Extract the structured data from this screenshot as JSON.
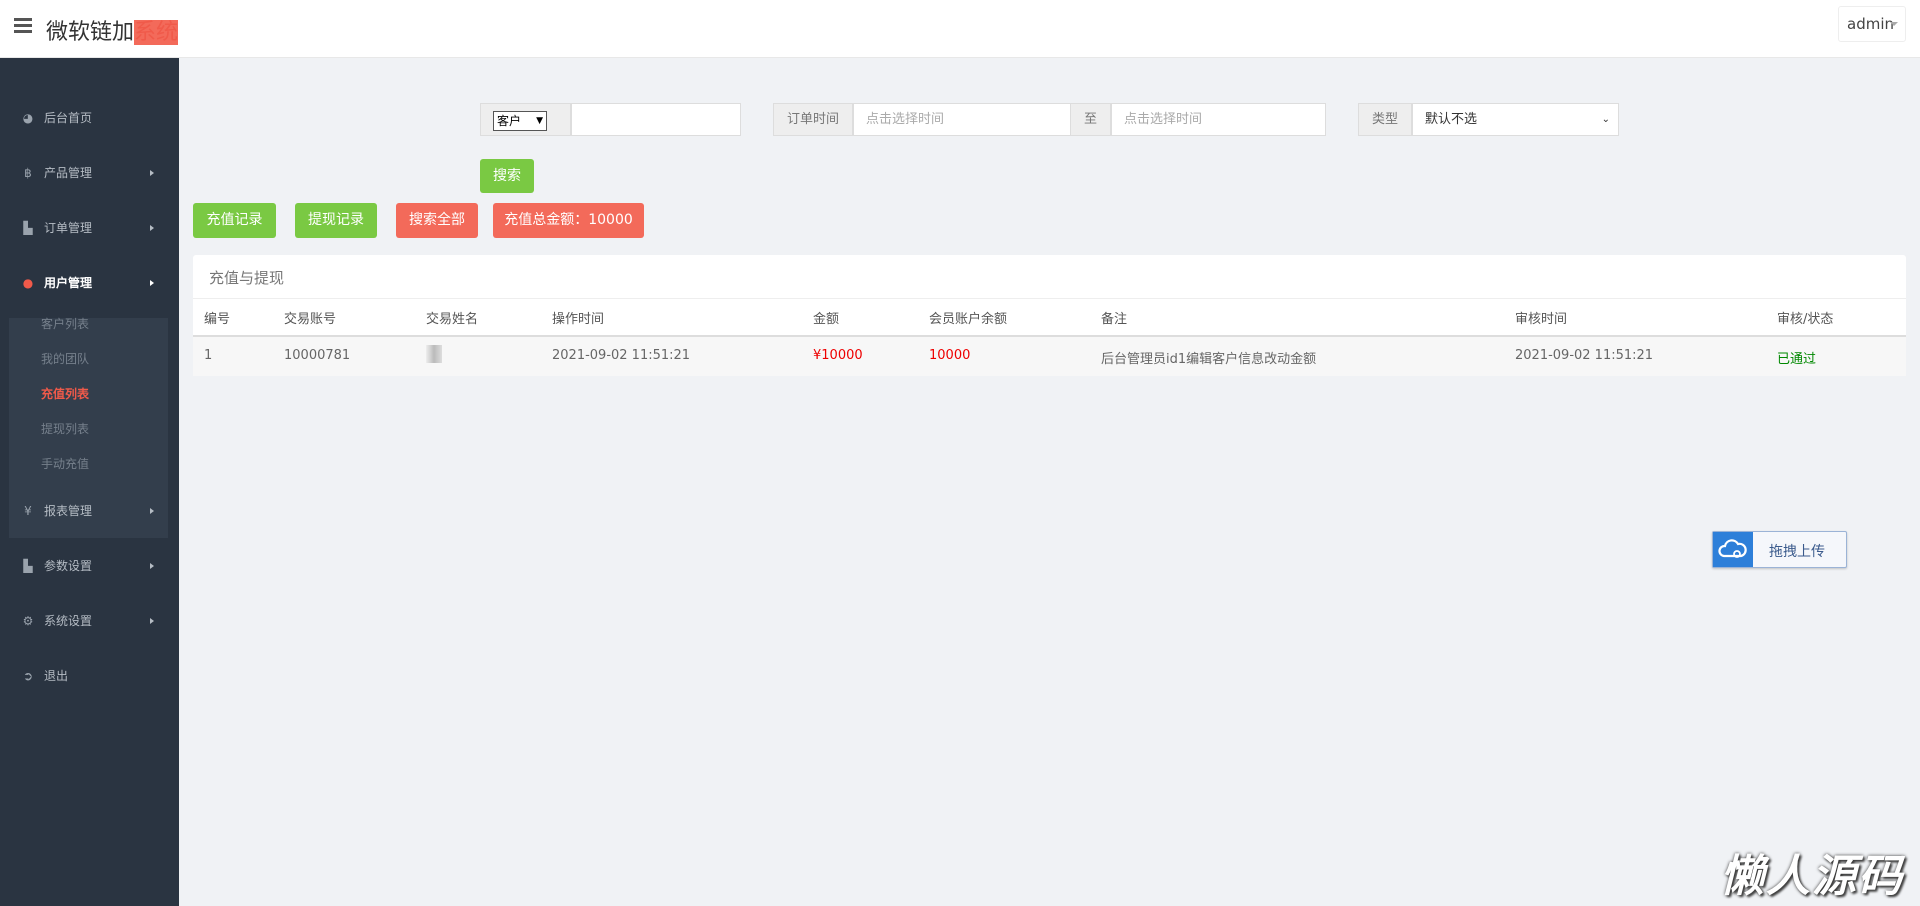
{
  "header": {
    "brand_main": "微软链加",
    "brand_accent": "系统",
    "user": "admin"
  },
  "sidebar": {
    "items": [
      {
        "label": "后台首页",
        "icon": "dashboard-icon"
      },
      {
        "label": "产品管理",
        "icon": "bitcoin-icon"
      },
      {
        "label": "订单管理",
        "icon": "files-icon"
      },
      {
        "label": "用户管理",
        "icon": "user-icon"
      },
      {
        "label": "报表管理",
        "icon": "yen-icon"
      },
      {
        "label": "参数设置",
        "icon": "files-icon"
      },
      {
        "label": "系统设置",
        "icon": "gears-icon"
      },
      {
        "label": "退出",
        "icon": "sign-out-icon"
      }
    ],
    "submenu": [
      "客户列表",
      "我的团队",
      "充值列表",
      "提现列表",
      "手动充值"
    ]
  },
  "filters": {
    "field_select": "客户",
    "field_value": "",
    "order_time_label": "订单时间",
    "time_placeholder": "点击选择时间",
    "to_label": "至",
    "type_label": "类型",
    "type_value": "默认不选",
    "search": "搜索"
  },
  "actions": {
    "recharge_records": "充值记录",
    "withdraw_records": "提现记录",
    "search_all": "搜索全部",
    "total": "充值总金额：10000"
  },
  "table": {
    "title": "充值与提现",
    "columns": [
      "编号",
      "交易账号",
      "交易姓名",
      "操作时间",
      "金额",
      "会员账户余额",
      "备注",
      "审核时间",
      "审核/状态"
    ],
    "rows": [
      [
        "1",
        "10000781",
        "",
        "2021-09-02 11:51:21",
        "¥10000",
        "10000",
        "后台管理员id1编辑客户信息改动金额",
        "2021-09-02 11:51:21",
        "已通过"
      ]
    ]
  },
  "upload": "拖拽上传",
  "watermark": "懒人源码"
}
